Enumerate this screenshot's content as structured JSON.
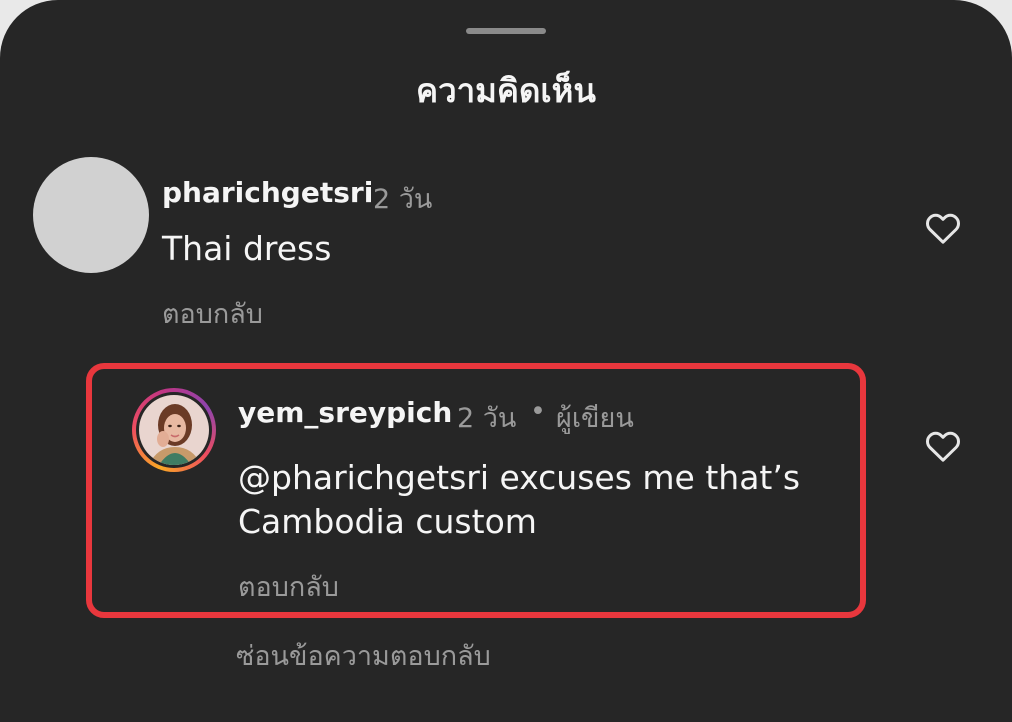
{
  "sheet": {
    "title": "ความคิดเห็น",
    "accent_highlight": "#e8373d",
    "background": "#262626"
  },
  "comments": [
    {
      "username": "pharichgetsri",
      "time": "2 วัน",
      "text": "Thai dress",
      "reply_label": "ตอบกลับ",
      "icon": "heart-outline-icon"
    }
  ],
  "replies": [
    {
      "username": "yem_sreypich",
      "time": "2 วัน",
      "separator": "•",
      "badge": "ผู้เขียน",
      "mention": "@pharichgetsri",
      "text_line1_rest": " excuses me that’s",
      "text_line2": "Cambodia custom",
      "reply_label": "ตอบกลับ",
      "icon": "heart-outline-icon"
    }
  ],
  "hide_replies_label": "ซ่อนข้อความตอบกลับ"
}
